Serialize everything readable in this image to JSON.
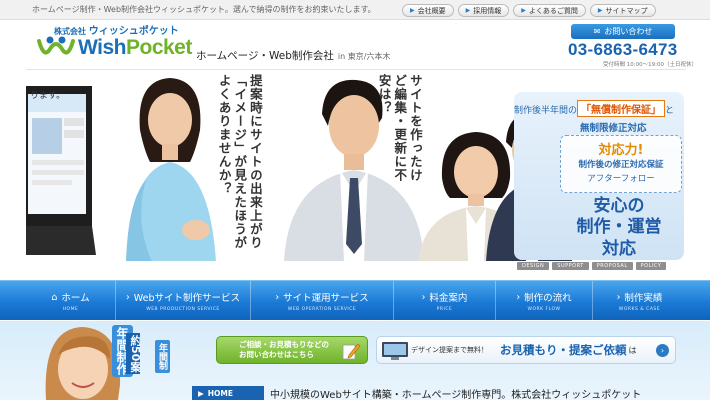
{
  "header": {
    "tagline": "ホームページ制作・Web制作会社ウィッシュポケット。選んで納得の制作をお約束いたします。",
    "topnav": [
      "会社概要",
      "採用情報",
      "よくあるご質問",
      "サイトマップ"
    ],
    "logo_company_prefix": "株式会社",
    "logo_company_kana": "ウィッシュポケット",
    "logo_wish": "Wish",
    "logo_pocket": "Pocket",
    "company_desc": "ホームページ・Web制作会社",
    "location": "in 東京/六本木",
    "contact_button": "お問い合わせ",
    "phone": "03-6863-6473",
    "hours": "受付時間 10:00〜19:00（土日祝休）"
  },
  "hero": {
    "laptop_text": "ります。",
    "copy_left": "提案時にサイトの出来上がり「イメージ」が見えたほうがよくありませんか？",
    "copy_mid": "サイトを作ったけど編集・更新に不安は？",
    "promo": {
      "line1_prefix": "制作後半年間の",
      "line1_highlight": "「無償制作保証」",
      "line1_suffix": "と",
      "line2": "無制限修正対応",
      "stamp_title": "対応力!",
      "stamp_sub1": "制作後の修正対応保証",
      "stamp_sub2": "アフターフォロー",
      "big_line1": "安心の",
      "big_line2": "制作・運営",
      "big_line3": "対応"
    },
    "tags": [
      "DESIGN",
      "SUPPORT",
      "PROPOSAL",
      "POLICY"
    ]
  },
  "gnav": [
    {
      "label": "ホーム",
      "sub": "HOME"
    },
    {
      "label": "Webサイト制作サービス",
      "sub": "WEB PRODUCTION SERVICE"
    },
    {
      "label": "サイト運用サービス",
      "sub": "WEB OPERATION SERVICE"
    },
    {
      "label": "料金案内",
      "sub": "PRICE"
    },
    {
      "label": "制作の流れ",
      "sub": "WORK FLOW"
    },
    {
      "label": "制作実績",
      "sub": "WORKS & CASE"
    }
  ],
  "lower": {
    "badge_top": "年間制作",
    "badge_num": "約50案",
    "badge_side": "年間制",
    "consult_line1": "ご相談・お見積もりなどの",
    "consult_line2": "お問い合わせはこちら",
    "estimate_free": "デザイン提案まで無料！",
    "estimate_req": "お見積もり・提案ご依頼",
    "estimate_ha": "は",
    "home_label": "HOME",
    "footline": "中小規模のWebサイト構築・ホームページ制作専門。株式会社ウィッシュポケット"
  },
  "colors": {
    "brand_blue": "#1a6fb8",
    "brand_green": "#6fb32a",
    "nav_blue": "#1b7ad6",
    "accent_orange": "#e58a00"
  }
}
